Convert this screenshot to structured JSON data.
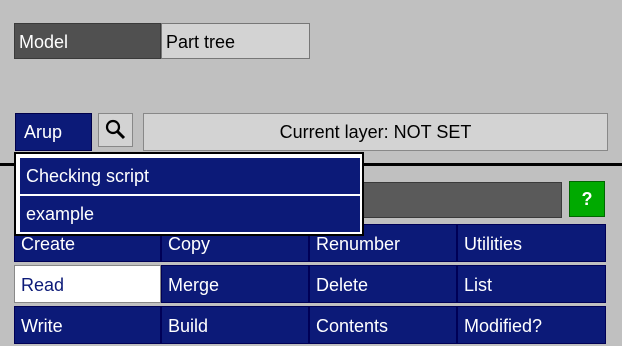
{
  "tabs": {
    "model": "Model",
    "part_tree": "Part tree"
  },
  "toolbar": {
    "arup_label": "Arup",
    "search_icon": "magnifier-icon",
    "current_layer": "Current layer: NOT SET"
  },
  "help_label": "?",
  "dropdown": {
    "items": [
      {
        "label": "Checking script"
      },
      {
        "label": "example"
      }
    ]
  },
  "grid": {
    "row1": [
      "Create",
      "Copy",
      "Renumber",
      "Utilities"
    ],
    "row2": [
      "Read",
      "Merge",
      "Delete",
      "List"
    ],
    "row3": [
      "Write",
      "Build",
      "Contents",
      "Modified?"
    ]
  },
  "colors": {
    "button_blue": "#0c1a78",
    "background": "#c0c0c0",
    "help_green": "#00aa00"
  }
}
